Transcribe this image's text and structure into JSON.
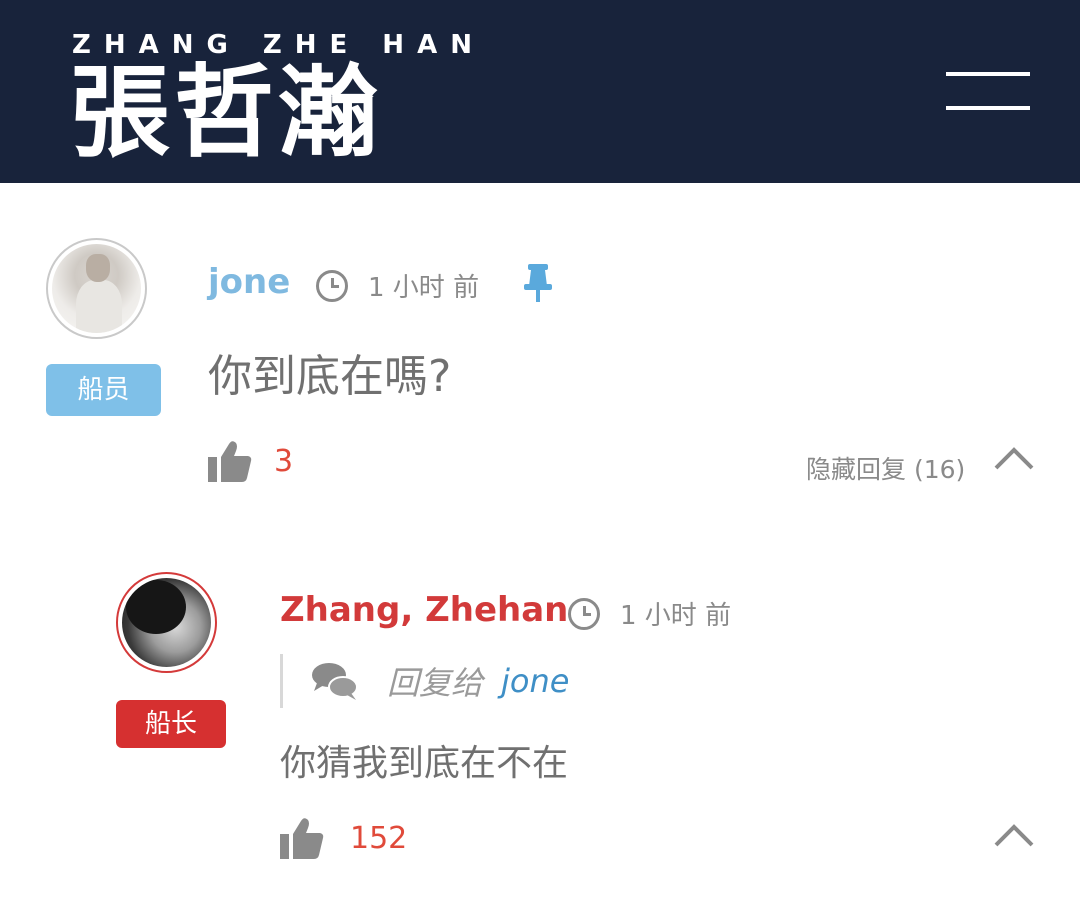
{
  "header": {
    "brand_latin": "ZHANG ZHE HAN",
    "brand_cjk": "張哲瀚",
    "menu_icon": "hamburger-menu-icon",
    "background": "#18233b"
  },
  "comments": [
    {
      "author": "jone",
      "badge": "船员",
      "time": "1 小时 前",
      "pinned": true,
      "content": "你到底在嗎?",
      "likes": "3",
      "hide_replies_label": "隐藏回复 (16)",
      "author_color": "#7fb9e0",
      "badge_color": "#7fc0e8"
    },
    {
      "author": "Zhang, Zhehan",
      "badge": "船长",
      "time": "1 小时 前",
      "reply_label": "回复给",
      "reply_target": "jone",
      "content": "你猜我到底在不在",
      "likes": "152",
      "author_color": "#d23a3a",
      "badge_color": "#d63030"
    }
  ],
  "colors": {
    "like_count": "#e04a3a",
    "meta_gray": "#8a8a8a"
  }
}
